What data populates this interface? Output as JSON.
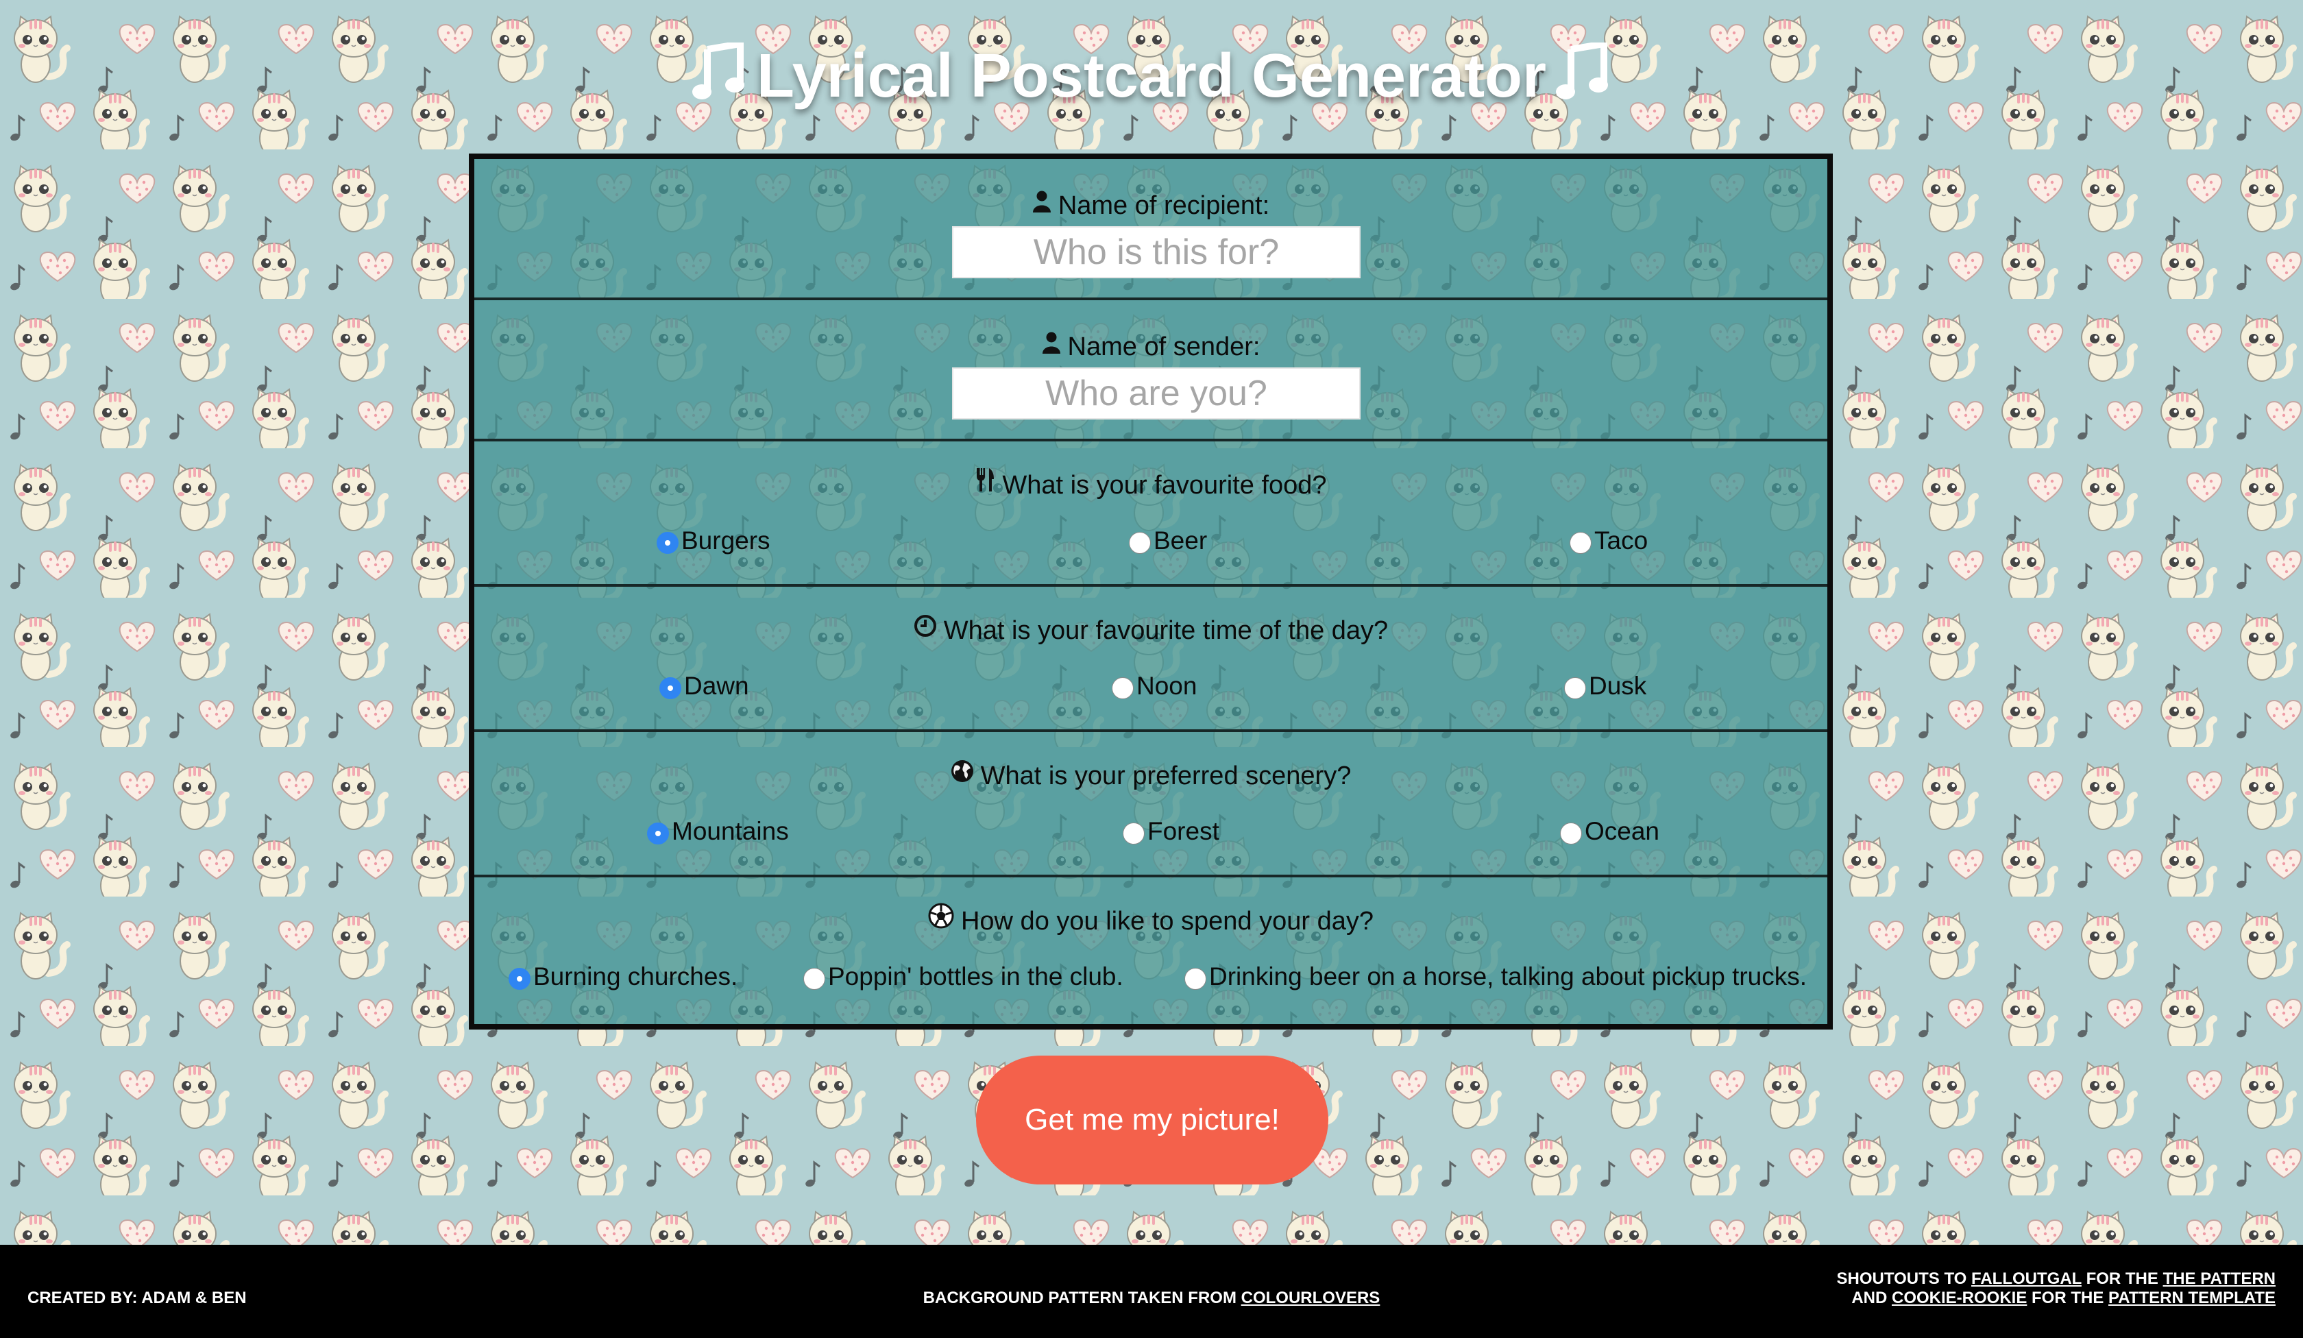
{
  "page": {
    "title": "Lyrical Postcard Generator"
  },
  "colors": {
    "panel": "#409292",
    "accent_button": "#f4614b",
    "radio_checked": "#2f85f2",
    "background": "#b3d1d3",
    "footer": "#000000"
  },
  "form": {
    "recipient": {
      "icon": "user-icon",
      "label": "Name of recipient:",
      "placeholder": "Who is this for?",
      "value": ""
    },
    "sender": {
      "icon": "user-icon",
      "label": "Name of sender:",
      "placeholder": "Who are you?",
      "value": ""
    },
    "food": {
      "icon": "cutlery-icon",
      "label": "What is your favourite food?",
      "selected": "Burgers",
      "options": [
        {
          "label": "Burgers"
        },
        {
          "label": "Beer"
        },
        {
          "label": "Taco"
        }
      ]
    },
    "time": {
      "icon": "clock-icon",
      "label": "What is your favourite time of the day?",
      "selected": "Dawn",
      "options": [
        {
          "label": "Dawn"
        },
        {
          "label": "Noon"
        },
        {
          "label": "Dusk"
        }
      ]
    },
    "scenery": {
      "icon": "globe-icon",
      "label": "What is your preferred scenery?",
      "selected": "Mountains",
      "options": [
        {
          "label": "Mountains"
        },
        {
          "label": "Forest"
        },
        {
          "label": "Ocean"
        }
      ]
    },
    "activity": {
      "icon": "soccer-ball-icon",
      "label": "How do you like to spend your day?",
      "selected": "Burning churches.",
      "options": [
        {
          "label": "Burning churches."
        },
        {
          "label": "Poppin' bottles in the club."
        },
        {
          "label": "Drinking beer on a horse, talking about pickup trucks."
        }
      ]
    },
    "submit_label": "Get me my picture!"
  },
  "footer": {
    "left": "Created by: Adam & Ben",
    "center_prefix": "Background pattern taken from",
    "center_link": "COLOURlovers",
    "right_line1_prefix": "Shoutouts to",
    "right_link1": "FalloutGal",
    "right_line1_mid": "for the",
    "right_link2": "the pattern",
    "right_line2_prefix": "and",
    "right_link3": "cookie-rookie",
    "right_line2_mid": "for the",
    "right_link4": "pattern template"
  }
}
